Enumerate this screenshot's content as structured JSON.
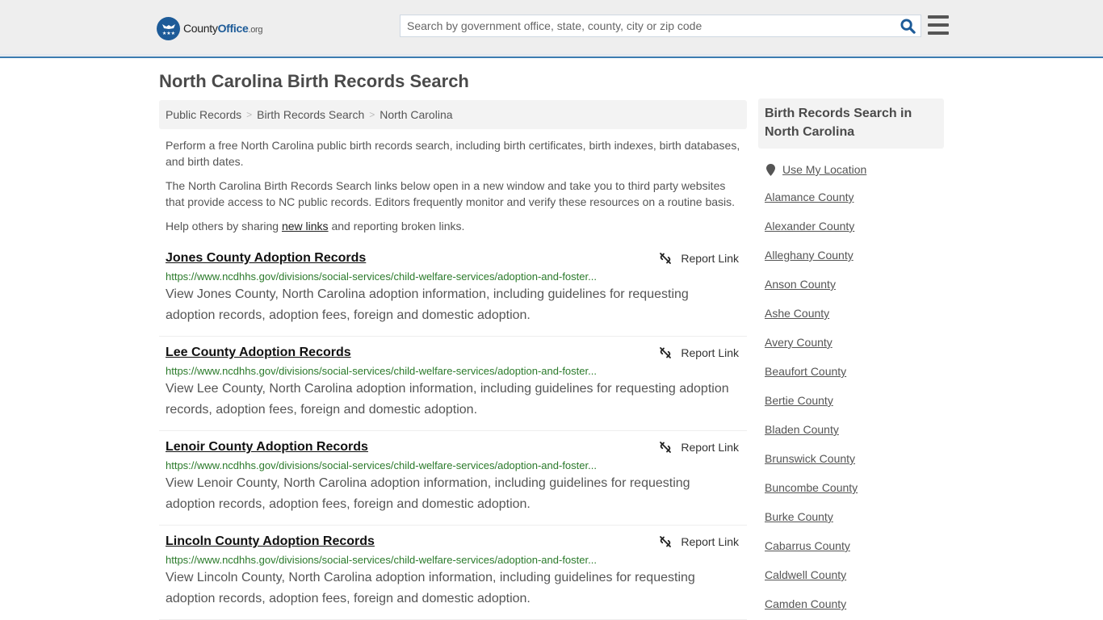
{
  "header": {
    "logo": {
      "name_part1": "County",
      "name_part2": "Office",
      "name_part3": ".org"
    },
    "search": {
      "placeholder": "Search by government office, state, county, city or zip code",
      "value": ""
    },
    "colors": {
      "accent": "#3b7bb0",
      "brand": "#1d5b98"
    }
  },
  "page": {
    "title": "North Carolina Birth Records Search",
    "breadcrumb": [
      "Public Records",
      "Birth Records Search",
      "North Carolina"
    ],
    "intro": {
      "p1": "Perform a free North Carolina public birth records search, including birth certificates, birth indexes, birth databases, and birth dates.",
      "p2": "The North Carolina Birth Records Search links below open in a new window and take you to third party websites that provide access to NC public records. Editors frequently monitor and verify these resources on a routine basis.",
      "p3_before": "Help others by sharing ",
      "p3_link": "new links",
      "p3_after": " and reporting broken links."
    }
  },
  "results": [
    {
      "title": "Jones County Adoption Records",
      "url": "https://www.ncdhhs.gov/divisions/social-services/child-welfare-services/adoption-and-foster...",
      "description": "View Jones County, North Carolina adoption information, including guidelines for requesting adoption records, adoption fees, foreign and domestic adoption.",
      "report_label": "Report Link"
    },
    {
      "title": "Lee County Adoption Records",
      "url": "https://www.ncdhhs.gov/divisions/social-services/child-welfare-services/adoption-and-foster...",
      "description": "View Lee County, North Carolina adoption information, including guidelines for requesting adoption records, adoption fees, foreign and domestic adoption.",
      "report_label": "Report Link"
    },
    {
      "title": "Lenoir County Adoption Records",
      "url": "https://www.ncdhhs.gov/divisions/social-services/child-welfare-services/adoption-and-foster...",
      "description": "View Lenoir County, North Carolina adoption information, including guidelines for requesting adoption records, adoption fees, foreign and domestic adoption.",
      "report_label": "Report Link"
    },
    {
      "title": "Lincoln County Adoption Records",
      "url": "https://www.ncdhhs.gov/divisions/social-services/child-welfare-services/adoption-and-foster...",
      "description": "View Lincoln County, North Carolina adoption information, including guidelines for requesting adoption records, adoption fees, foreign and domestic adoption.",
      "report_label": "Report Link"
    }
  ],
  "sidebar": {
    "heading": "Birth Records Search in North Carolina",
    "location_label": "Use My Location",
    "counties": [
      "Alamance County",
      "Alexander County",
      "Alleghany County",
      "Anson County",
      "Ashe County",
      "Avery County",
      "Beaufort County",
      "Bertie County",
      "Bladen County",
      "Brunswick County",
      "Buncombe County",
      "Burke County",
      "Cabarrus County",
      "Caldwell County",
      "Camden County"
    ]
  }
}
